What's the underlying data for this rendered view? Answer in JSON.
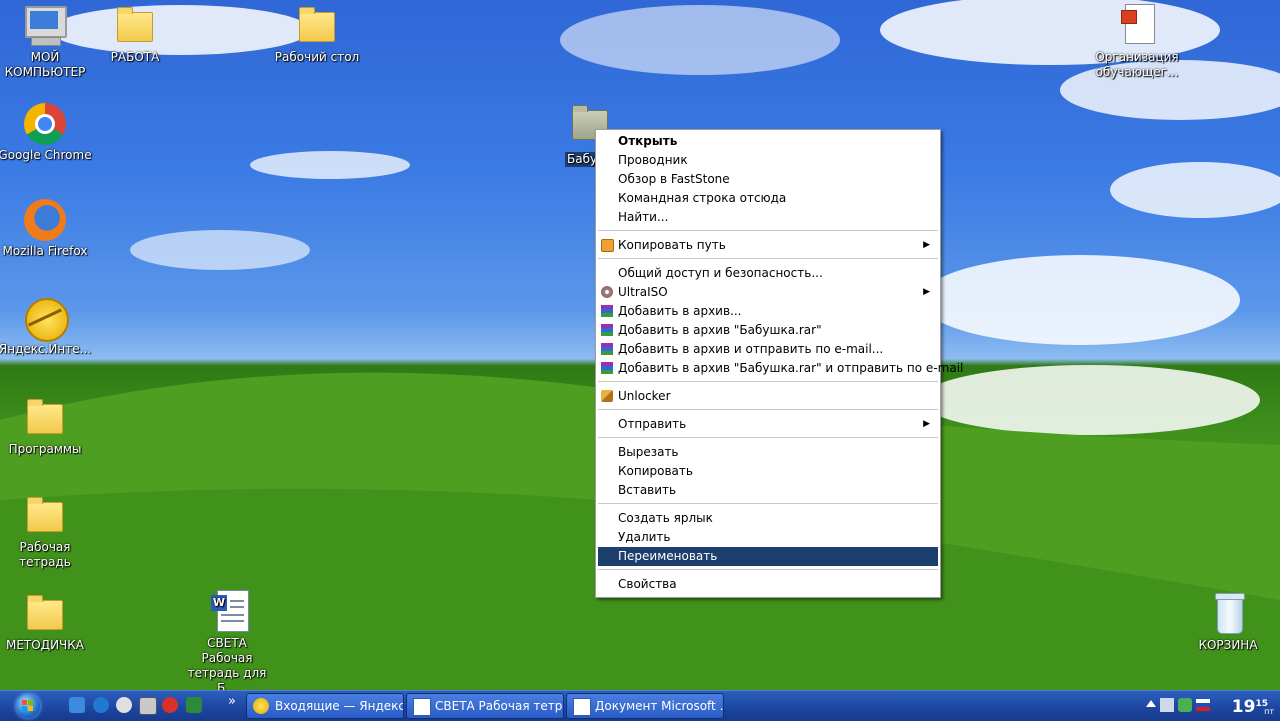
{
  "desktop": {
    "icons": [
      {
        "label": "МОЙ КОМПЬЮТЕР",
        "kind": "computer-icon"
      },
      {
        "label": "РАБОТА",
        "kind": "folder-icon"
      },
      {
        "label": "Рабочий стол",
        "kind": "folder-icon"
      },
      {
        "label": "Организация обучающег...",
        "kind": "document-icon"
      },
      {
        "label": "Google Chrome",
        "kind": "chrome-icon"
      },
      {
        "label": "Mozilla Firefox",
        "kind": "firefox-icon"
      },
      {
        "label": "Яндекс.Инте...",
        "kind": "yandex-internet-icon"
      },
      {
        "label": "Программы",
        "kind": "folder-icon"
      },
      {
        "label": "Рабочая тетрадь",
        "kind": "folder-icon"
      },
      {
        "label": "МЕТОДИЧКА",
        "kind": "folder-icon"
      },
      {
        "label": "СВЕТА Рабочая тетрадь для Б...",
        "kind": "word-document-icon"
      },
      {
        "label": "КОРЗИНА",
        "kind": "recycle-bin-icon"
      },
      {
        "label": "Бабу",
        "kind": "folder-icon"
      }
    ]
  },
  "context_menu": {
    "items": [
      {
        "label": "Открыть",
        "bold": true
      },
      {
        "label": "Проводник"
      },
      {
        "label": "Обзор в FastStone"
      },
      {
        "label": "Командная строка отсюда"
      },
      {
        "label": "Найти..."
      },
      {
        "label": "Копировать путь",
        "icon": "copy-path-icon",
        "submenu": true
      },
      {
        "label": "Общий доступ и безопасность..."
      },
      {
        "label": "UltraISO",
        "icon": "ultraiso-icon",
        "submenu": true
      },
      {
        "label": "Добавить в архив...",
        "icon": "winrar-icon"
      },
      {
        "label": "Добавить в архив \"Бабушка.rar\"",
        "icon": "winrar-icon"
      },
      {
        "label": "Добавить в архив и отправить по e-mail...",
        "icon": "winrar-icon"
      },
      {
        "label": "Добавить в архив \"Бабушка.rar\" и отправить по e-mail",
        "icon": "winrar-icon"
      },
      {
        "label": "Unlocker",
        "icon": "unlocker-icon"
      },
      {
        "label": "Отправить",
        "submenu": true
      },
      {
        "label": "Вырезать"
      },
      {
        "label": "Копировать"
      },
      {
        "label": "Вставить"
      },
      {
        "label": "Создать ярлык"
      },
      {
        "label": "Удалить"
      },
      {
        "label": "Переименовать",
        "selected": true
      },
      {
        "label": "Свойства"
      }
    ],
    "submenu_arrow": "▶"
  },
  "taskbar": {
    "quick_launch": [
      "ie-icon",
      "edge-icon",
      "media-icon",
      "floppy-icon",
      "opera-icon",
      "excel-icon"
    ],
    "overflow": "»",
    "buttons": [
      {
        "label": "Входящие — Яндекс...",
        "icon": "yandex-browser-icon"
      },
      {
        "label": "СВЕТА Рабочая тетр...",
        "icon": "word-icon"
      },
      {
        "label": "Документ Microsoft ...",
        "icon": "word-icon"
      }
    ],
    "tray_icons": [
      "network-icon",
      "security-icon",
      "language-icon"
    ],
    "clock_hours": "19",
    "clock_minutes": "15",
    "clock_suffix": "пт"
  },
  "colors": {
    "menu_selection": "#1c3f6e",
    "taskbar": "#1f49a3"
  }
}
